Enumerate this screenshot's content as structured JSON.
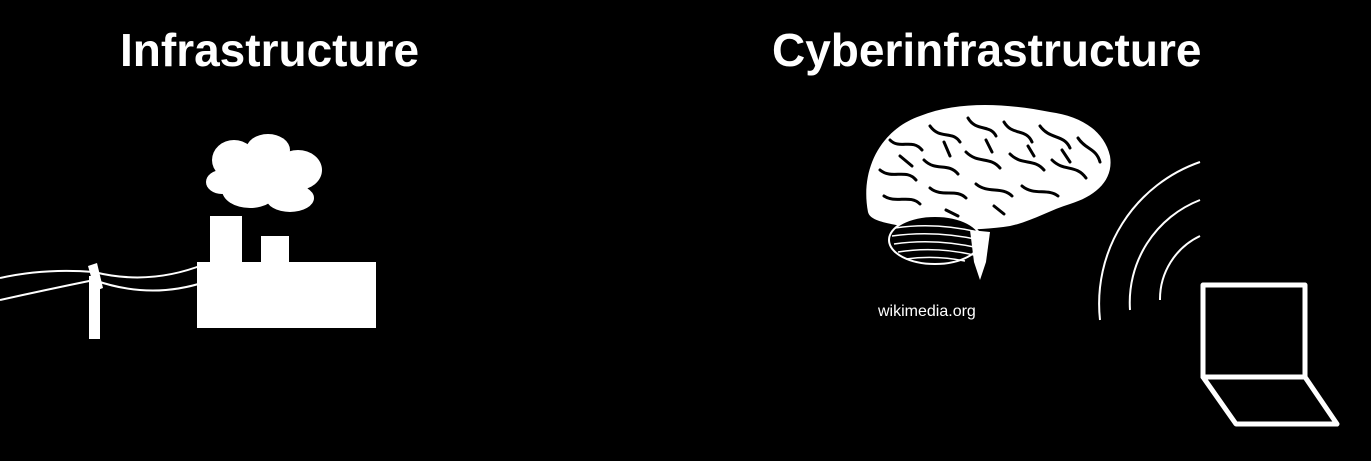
{
  "left_panel": {
    "title": "Infrastructure",
    "icons": [
      "power-line-icon",
      "utility-pole-icon",
      "factory-icon",
      "smoke-cloud-icon"
    ]
  },
  "right_panel": {
    "title": "Cyberinfrastructure",
    "image_credit": "wikimedia.org",
    "icons": [
      "brain-icon",
      "wireless-signal-icon",
      "laptop-icon"
    ]
  },
  "colors": {
    "background": "#000000",
    "foreground": "#ffffff"
  }
}
